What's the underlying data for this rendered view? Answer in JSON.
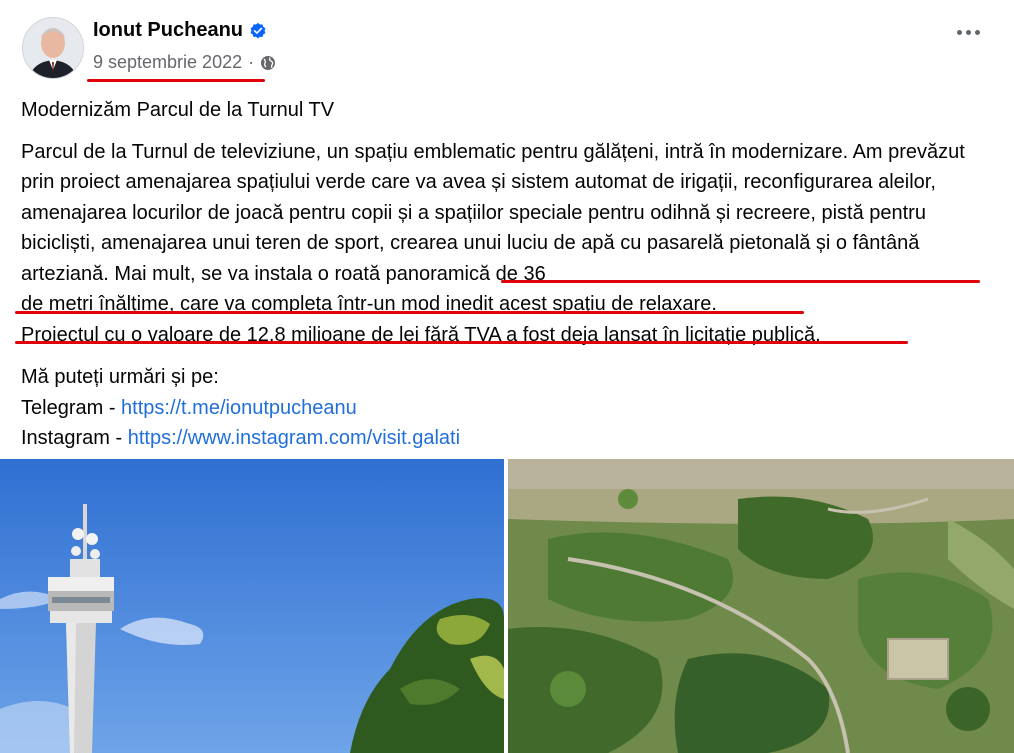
{
  "post": {
    "author": "Ionut Pucheanu",
    "date": "9 septembrie 2022",
    "separator": "·",
    "title": "Modernizăm Parcul de la Turnul TV",
    "paragraph_part1": "Parcul de la Turnul de televiziune, un spațiu emblematic pentru gălățeni, intră în modernizare. Am prevăzut prin proiect amenajarea spațiului verde care va avea și sistem automat de irigații, reconfigurarea aleilor, amenajarea locurilor de joacă pentru copii și a spațiilor speciale pentru odihnă și recreere, pistă pentru bicicliști, amenajarea unui teren de sport, crearea unui luciu de apă cu pasarelă pietonală și o fântână arteziană. ",
    "paragraph_highlight_a": "Mai mult, se va instala o roată panoramică de 36",
    "paragraph_highlight_b": "de metri înălțime, care va completa într-un mod inedit acest spațiu de relaxare.",
    "paragraph_highlight_c": "Proiectul cu o valoare de 12,8 milioane de lei fără TVA a fost deja lansat în licitație publică.",
    "follow_intro": "Mă puteți urmări și pe:",
    "telegram_label": "Telegram - ",
    "telegram_url": "https://t.me/ionutpucheanu",
    "instagram_label": "Instagram - ",
    "instagram_url": "https://www.instagram.com/visit.galati"
  },
  "icons": {
    "verified": "verified-badge-icon",
    "audience": "globe-icon",
    "menu": "more-options-icon"
  },
  "colors": {
    "link": "#216fdb",
    "verified": "#0866ff",
    "annotation": "#e0000a"
  }
}
